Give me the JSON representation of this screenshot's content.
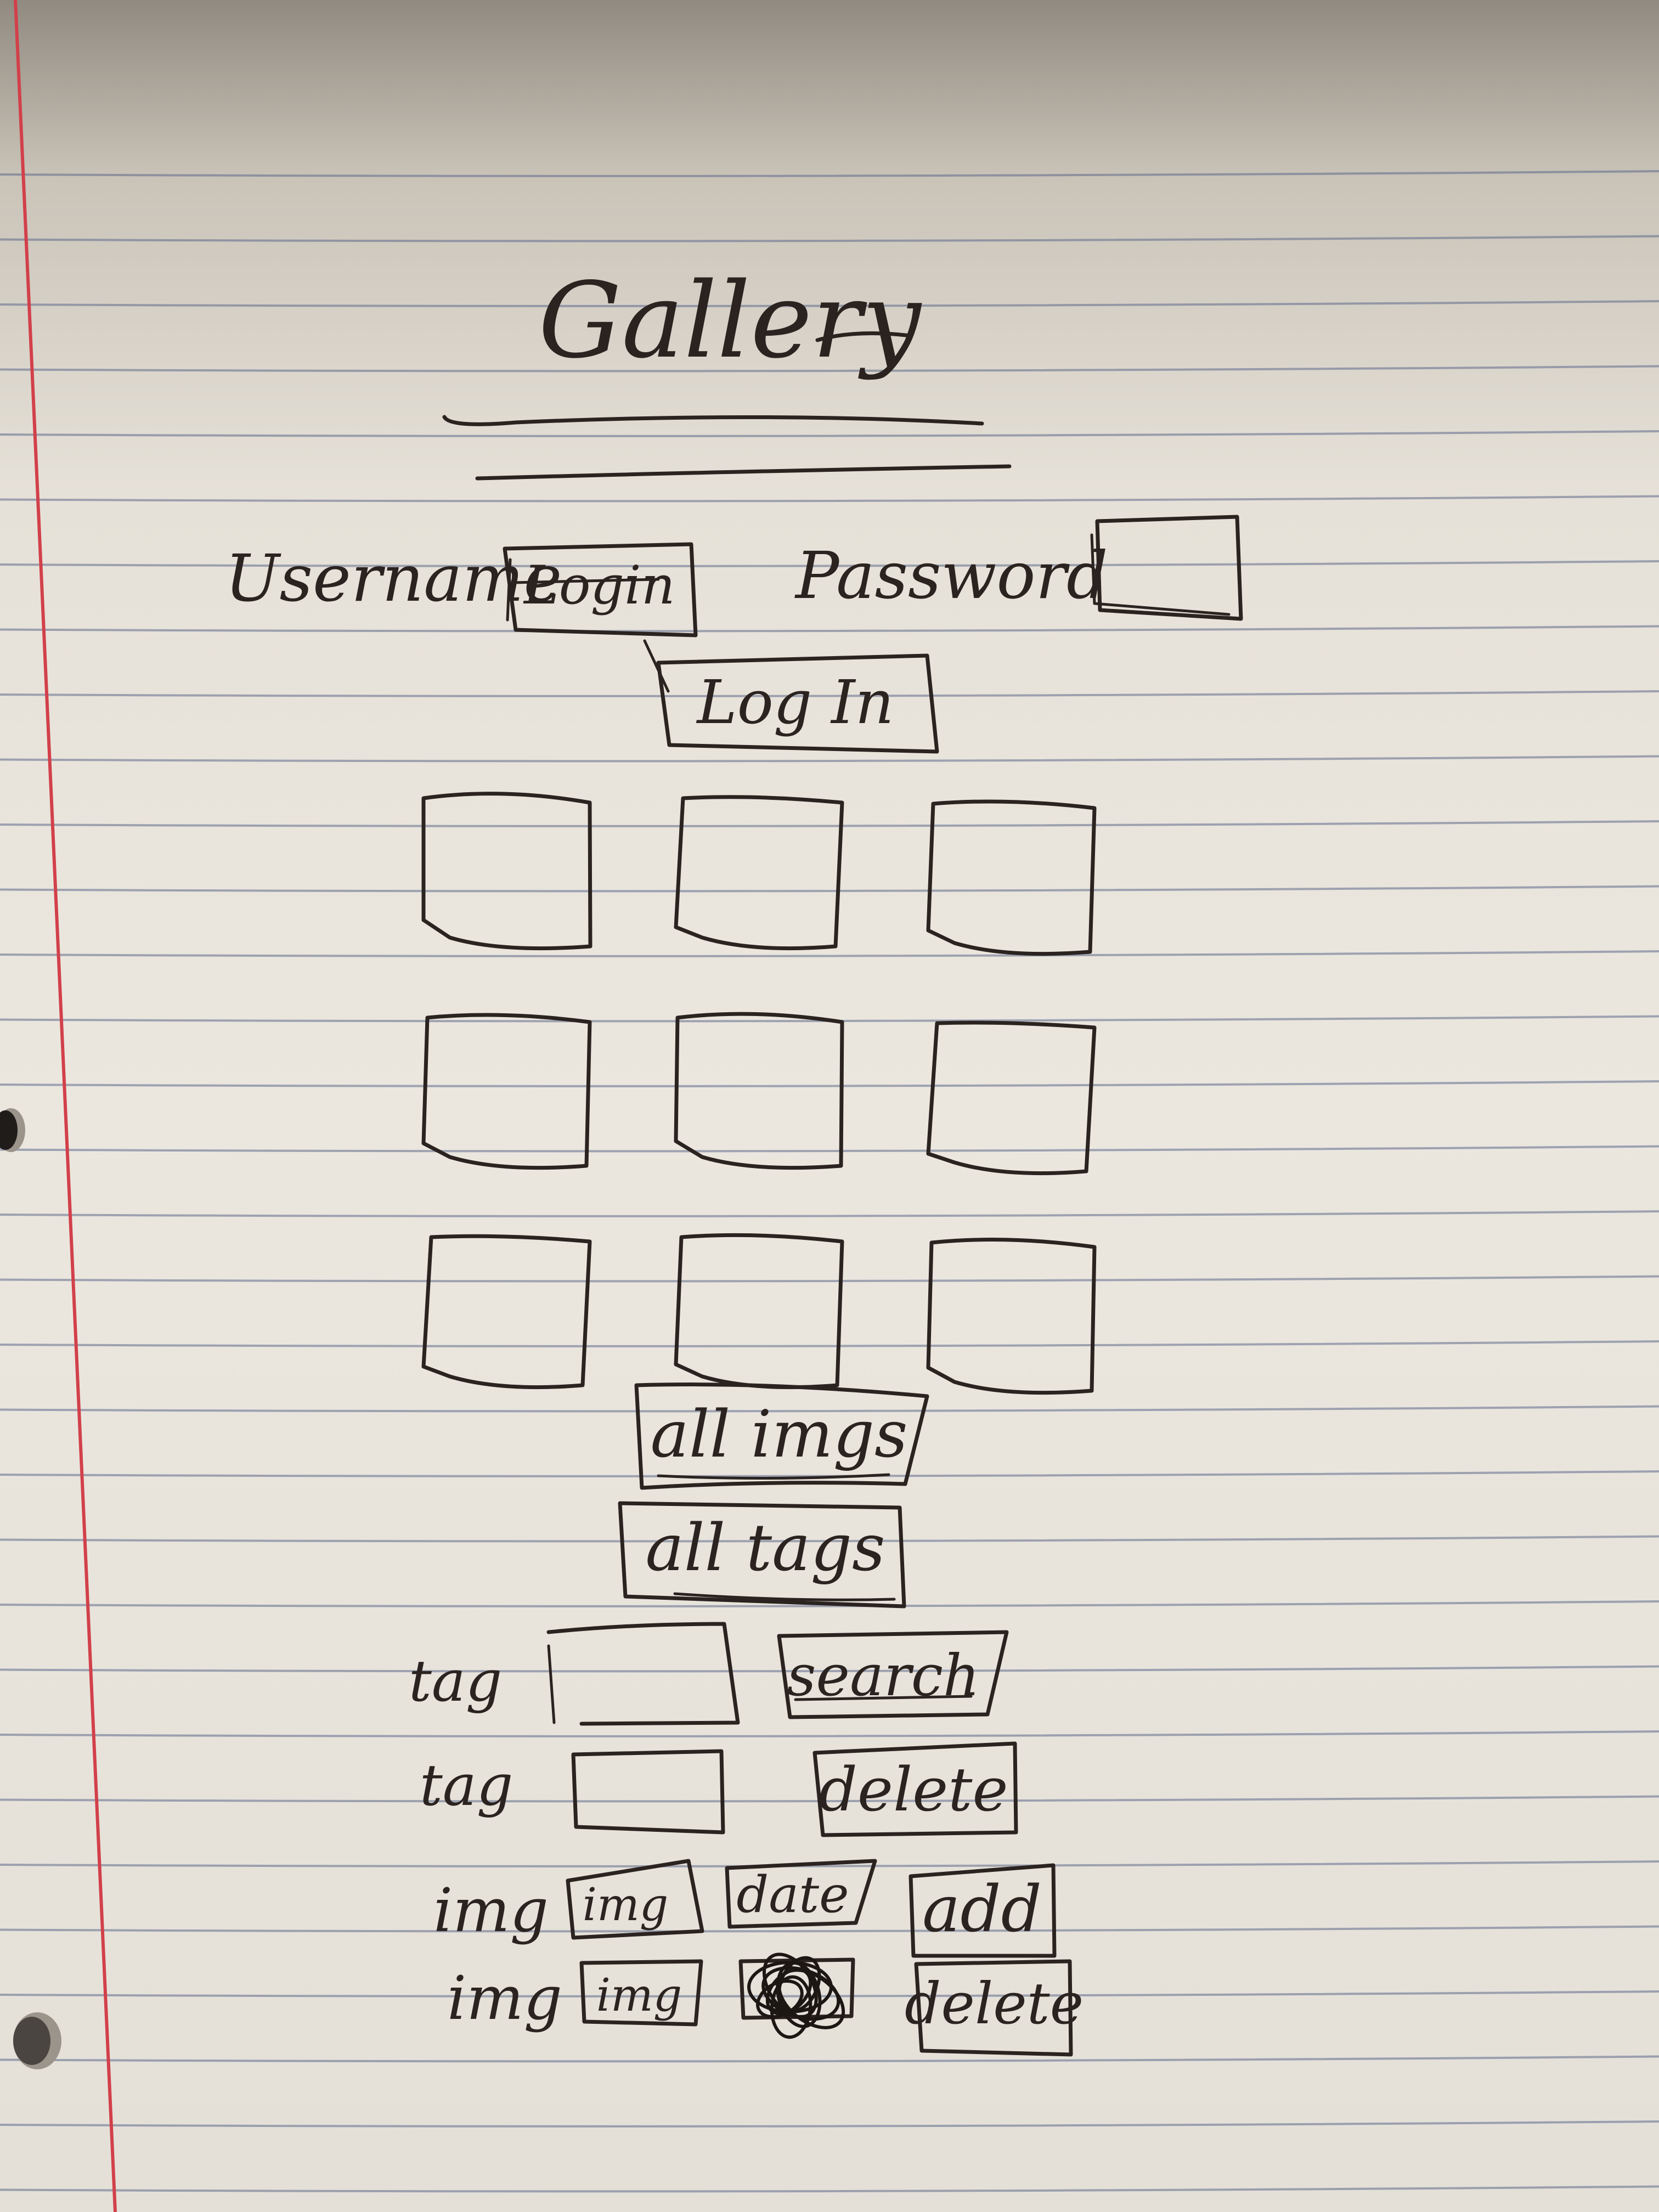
{
  "title": "Gallery",
  "login": {
    "username_label": "Username",
    "username_value": "Login",
    "password_label": "Password",
    "button_label": "Log In"
  },
  "grid": {
    "rows": 3,
    "cols": 3
  },
  "buttons": {
    "all_images": "all imgs",
    "all_tags": "all tags"
  },
  "tag_search": {
    "label": "tag",
    "button": "search"
  },
  "tag_delete": {
    "label": "tag",
    "button": "delete"
  },
  "image_add": {
    "label": "img",
    "image_field": "img",
    "date_field": "date",
    "button": "add"
  },
  "image_delete": {
    "label": "img",
    "image_field": "img",
    "button": "delete"
  },
  "colors": {
    "paper": "#ebe7df",
    "ruled_line": "#5f6a8a",
    "margin_line": "#d2404a",
    "ink": "#2b2320"
  }
}
